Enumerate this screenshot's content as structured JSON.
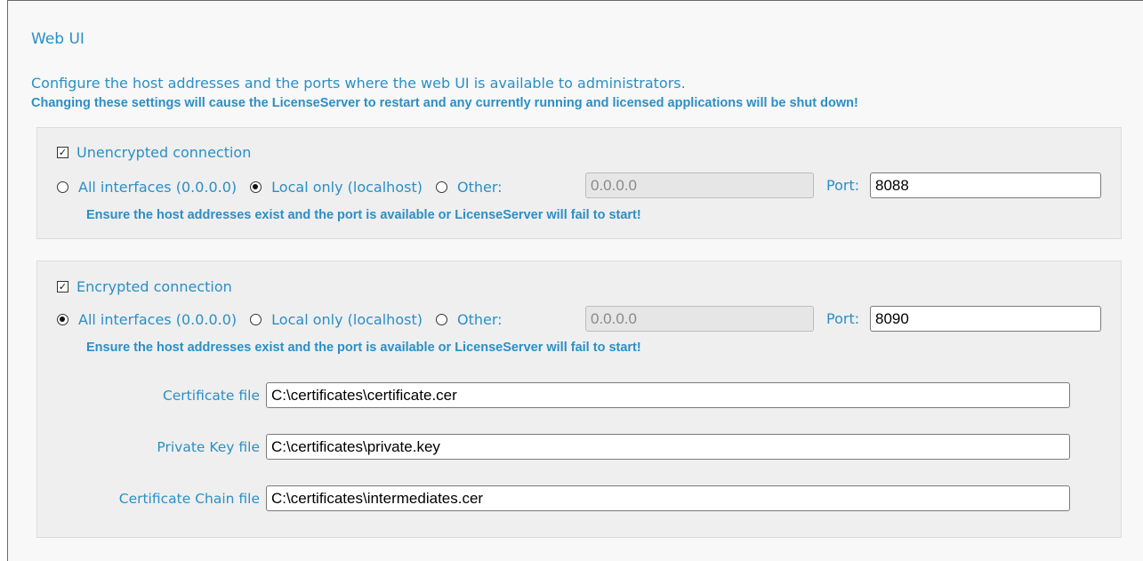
{
  "section": {
    "title": "Web UI",
    "description": "Configure the host addresses and the ports where the web UI is available to administrators.",
    "warning": "Changing these settings will cause the LicenseServer to restart and any currently running and licensed applications will be shut down!"
  },
  "unencrypted": {
    "checkbox_label": "Unencrypted connection",
    "checked": true,
    "options": [
      "All interfaces (0.0.0.0)",
      "Local only (localhost)",
      "Other:"
    ],
    "selected": "Local only (localhost)",
    "other_value": "0.0.0.0",
    "port_label": "Port:",
    "port_value": "8088",
    "warning": "Ensure the host addresses exist and the port is available or LicenseServer will fail to start!"
  },
  "encrypted": {
    "checkbox_label": "Encrypted connection",
    "checked": true,
    "options": [
      "All interfaces (0.0.0.0)",
      "Local only (localhost)",
      "Other:"
    ],
    "selected": "All interfaces (0.0.0.0)",
    "other_value": "0.0.0.0",
    "port_label": "Port:",
    "port_value": "8090",
    "warning": "Ensure the host addresses exist and the port is available or LicenseServer will fail to start!",
    "certificate_file_label": "Certificate file",
    "certificate_file_value": "C:\\certificates\\certificate.cer",
    "private_key_file_label": "Private Key file",
    "private_key_file_value": "C:\\certificates\\private.key",
    "certificate_chain_file_label": "Certificate Chain file",
    "certificate_chain_file_value": "C:\\certificates\\intermediates.cer"
  },
  "icons": {
    "checkbox": "checkbox-checked-icon",
    "radio": "radio-icon"
  },
  "colors": {
    "accent": "#2a8fc6",
    "panel": "#efefef"
  }
}
